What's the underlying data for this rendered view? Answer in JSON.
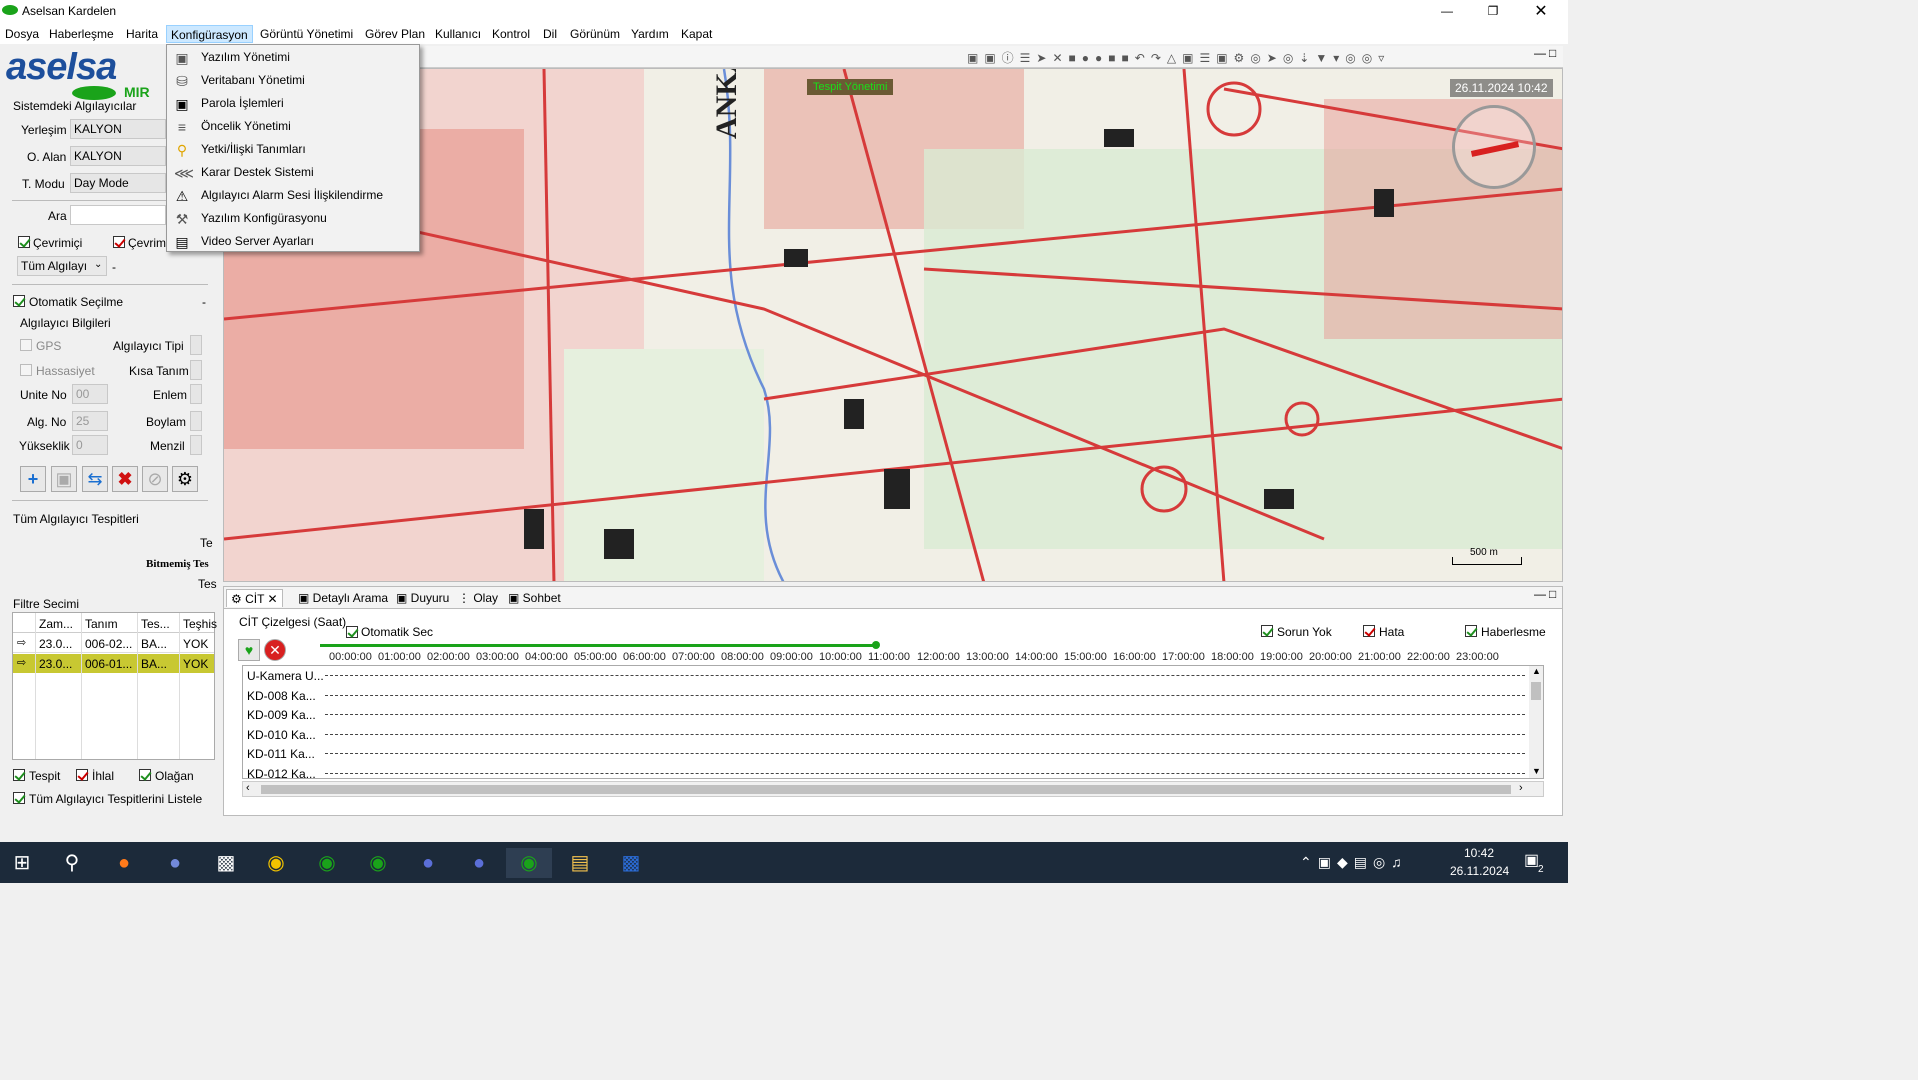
{
  "app": {
    "title": "Aselsan Kardelen",
    "logo_text": "aselsa",
    "logo_sub": "MIR"
  },
  "menubar": [
    "Dosya",
    "Haberleşme",
    "Harita",
    "Konfigürasyon",
    "Görüntü Yönetimi",
    "Görev Plan",
    "Kullanıcı",
    "Kontrol",
    "Dil",
    "Görünüm",
    "Yardım",
    "Kapat"
  ],
  "dropdown": [
    {
      "label": "Yazılım Yönetimi",
      "icon": "monitor-icon"
    },
    {
      "label": "Veritabanı Yönetimi",
      "icon": "database-icon"
    },
    {
      "label": "Parola İşlemleri",
      "icon": "lock-icon"
    },
    {
      "label": "Öncelik Yönetimi",
      "icon": "priority-icon"
    },
    {
      "label": "Yetki/İlişki Tanımları",
      "icon": "key-icon"
    },
    {
      "label": "Karar Destek Sistemi",
      "icon": "network-icon"
    },
    {
      "label": "Algılayıcı Alarm Sesi İlişkilendirme",
      "icon": "bell-icon"
    },
    {
      "label": "Yazılım Konfigürasyonu",
      "icon": "wrench-icon"
    },
    {
      "label": "Video Server Ayarları",
      "icon": "video-server-icon"
    }
  ],
  "left": {
    "section_title": "Sistemdeki Algılayıcılar",
    "yerlesim_label": "Yerleşim",
    "yerlesim_value": "KALYON",
    "oalan_label": "O. Alan",
    "oalan_value": "KALYON",
    "tmodu_label": "T. Modu",
    "tmodu_value": "Day Mode",
    "ara_label": "Ara",
    "cevrimici": "Çevrimiçi",
    "cevrimdisi": "Çevrim",
    "tum_algilayici": "Tüm Algılayı",
    "dash": "-",
    "otomatik": "Otomatik Seçilme",
    "otomatik_dash": "-",
    "bilgiler": "Algılayıcı Bilgileri",
    "gps": "GPS",
    "alg_tipi": "Algılayıcı Tipi",
    "hassasiyet": "Hassasiyet",
    "kisa_tanim": "Kısa Tanım",
    "unite_label": "Unite No",
    "unite_value": "00",
    "enlem": "Enlem",
    "algno_label": "Alg. No",
    "algno_value": "25",
    "boylam": "Boylam",
    "yukseklik_label": "Yükseklik",
    "yukseklik_value": "0",
    "menzil": "Menzil",
    "tespitler": "Tüm Algılayıcı Tespitleri",
    "te": "Te",
    "bitmemis": "Bitmemiş Tes",
    "tes": "Tes",
    "filtre": "Filtre Secimi",
    "table_headers": [
      "Zam...",
      "Tanım",
      "Tes...",
      "Teşhis"
    ],
    "table_rows": [
      [
        "23.0...",
        "006-02...",
        "BA...",
        "YOK"
      ],
      [
        "23.0...",
        "006-01...",
        "BA...",
        "YOK"
      ]
    ],
    "tespit": "Tespit",
    "ihlal": "İhlal",
    "olagan": "Olağan",
    "listele": "Tüm Algılayıcı Tespitlerini Listele"
  },
  "map": {
    "city_label": "ANKARA",
    "tespit_label": "Tespit Yönetimi",
    "datetime": "26.11.2024 10:42",
    "scale": "500 m"
  },
  "bottom": {
    "tabs": [
      "CİT",
      "Detaylı Arama",
      "Duyuru",
      "Olay",
      "Sohbet"
    ],
    "cit_title": "CİT Çizelgesi (Saat)",
    "otomatik_sec": "Otomatik Sec",
    "sorun_yok": "Sorun Yok",
    "hata": "Hata",
    "haberlesme": "Haberlesme",
    "hours": [
      "00:00:00",
      "01:00:00",
      "02:00:00",
      "03:00:00",
      "04:00:00",
      "05:00:00",
      "06:00:00",
      "07:00:00",
      "08:00:00",
      "09:00:00",
      "10:00:00",
      "11:00:00",
      "12:00:00",
      "13:00:00",
      "14:00:00",
      "15:00:00",
      "16:00:00",
      "17:00:00",
      "18:00:00",
      "19:00:00",
      "20:00:00",
      "21:00:00",
      "22:00:00",
      "23:00:00"
    ],
    "rows": [
      "U-Kamera U...",
      "KD-008 Ka...",
      "KD-009 Ka...",
      "KD-010 Ka...",
      "KD-011 Ka...",
      "KD-012 Ka..."
    ]
  },
  "taskbar": {
    "time": "10:42",
    "date": "26.11.2024",
    "notif_count": "2"
  },
  "colors": {
    "accent": "#cce8ff",
    "road": "#d63a3a",
    "selected_row": "#c8c832"
  }
}
